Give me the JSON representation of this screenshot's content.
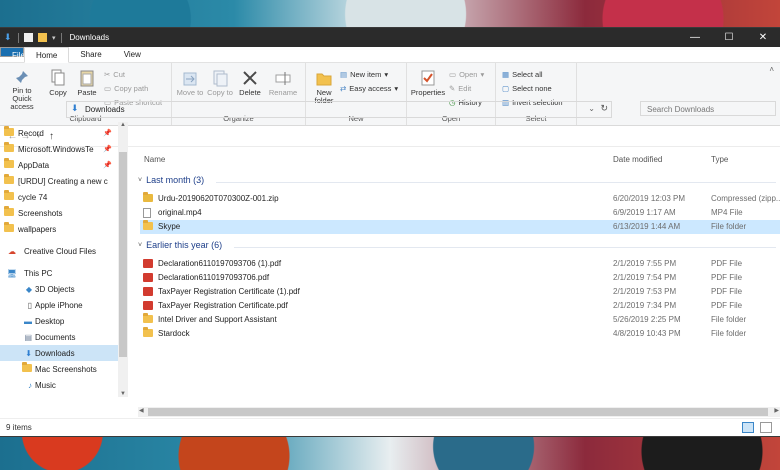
{
  "window": {
    "title": "Downloads"
  },
  "titlebar": {
    "minimize": "—",
    "maximize": "☐",
    "close": "✕"
  },
  "tabs": [
    "File",
    "Home",
    "Share",
    "View"
  ],
  "ribbon": {
    "clipboard": {
      "pin": "Pin to Quick access",
      "copy": "Copy",
      "paste": "Paste",
      "cut": "Cut",
      "copy_path": "Copy path",
      "paste_shortcut": "Paste shortcut",
      "label": "Clipboard"
    },
    "organize": {
      "move_to": "Move to",
      "copy_to": "Copy to",
      "delete": "Delete",
      "rename": "Rename",
      "label": "Organize"
    },
    "new": {
      "new_folder": "New folder",
      "new_item": "New item",
      "easy_access": "Easy access",
      "label": "New"
    },
    "open": {
      "properties": "Properties",
      "open": "Open",
      "edit": "Edit",
      "history": "History",
      "label": "Open"
    },
    "select": {
      "select_all": "Select all",
      "select_none": "Select none",
      "invert": "Invert selection",
      "label": "Select"
    }
  },
  "address": {
    "path": "Downloads",
    "search_placeholder": "Search Downloads"
  },
  "sidebar": [
    {
      "label": "Record",
      "pinned": true
    },
    {
      "label": "Microsoft.WindowsTe",
      "pinned": true
    },
    {
      "label": "AppData",
      "pinned": true
    },
    {
      "label": "[URDU] Creating a new c",
      "pinned": false
    },
    {
      "label": "cycle 74",
      "pinned": false
    },
    {
      "label": "Screenshots",
      "pinned": false
    },
    {
      "label": "wallpapers",
      "pinned": false
    },
    {
      "label": "Creative Cloud Files",
      "pinned": false
    },
    {
      "label": "This PC",
      "pinned": false
    },
    {
      "label": "3D Objects",
      "pinned": false
    },
    {
      "label": "Apple iPhone",
      "pinned": false
    },
    {
      "label": "Desktop",
      "pinned": false
    },
    {
      "label": "Documents",
      "pinned": false
    },
    {
      "label": "Downloads",
      "pinned": false
    },
    {
      "label": "Mac Screenshots",
      "pinned": false
    },
    {
      "label": "Music",
      "pinned": false
    }
  ],
  "columns": {
    "name": "Name",
    "date": "Date modified",
    "type": "Type"
  },
  "groups": [
    {
      "title": "Last month (3)",
      "files": [
        {
          "name": "Urdu-20190620T070300Z-001.zip",
          "date": "6/20/2019 12:03 PM",
          "type": "Compressed (zipp..."
        },
        {
          "name": "original.mp4",
          "date": "6/9/2019 1:17 AM",
          "type": "MP4 File"
        },
        {
          "name": "Skype",
          "date": "6/13/2019 1:44 AM",
          "type": "File folder"
        }
      ]
    },
    {
      "title": "Earlier this year (6)",
      "files": [
        {
          "name": "Declaration6110197093706 (1).pdf",
          "date": "2/1/2019 7:55 PM",
          "type": "PDF File"
        },
        {
          "name": "Declaration6110197093706.pdf",
          "date": "2/1/2019 7:54 PM",
          "type": "PDF File"
        },
        {
          "name": "TaxPayer Registration Certificate (1).pdf",
          "date": "2/1/2019 7:53 PM",
          "type": "PDF File"
        },
        {
          "name": "TaxPayer Registration Certificate.pdf",
          "date": "2/1/2019 7:34 PM",
          "type": "PDF File"
        },
        {
          "name": "Intel Driver and Support Assistant",
          "date": "5/26/2019 2:25 PM",
          "type": "File folder"
        },
        {
          "name": "Stardock",
          "date": "4/8/2019 10:43 PM",
          "type": "File folder"
        }
      ]
    }
  ],
  "status": {
    "items": "9 items"
  }
}
